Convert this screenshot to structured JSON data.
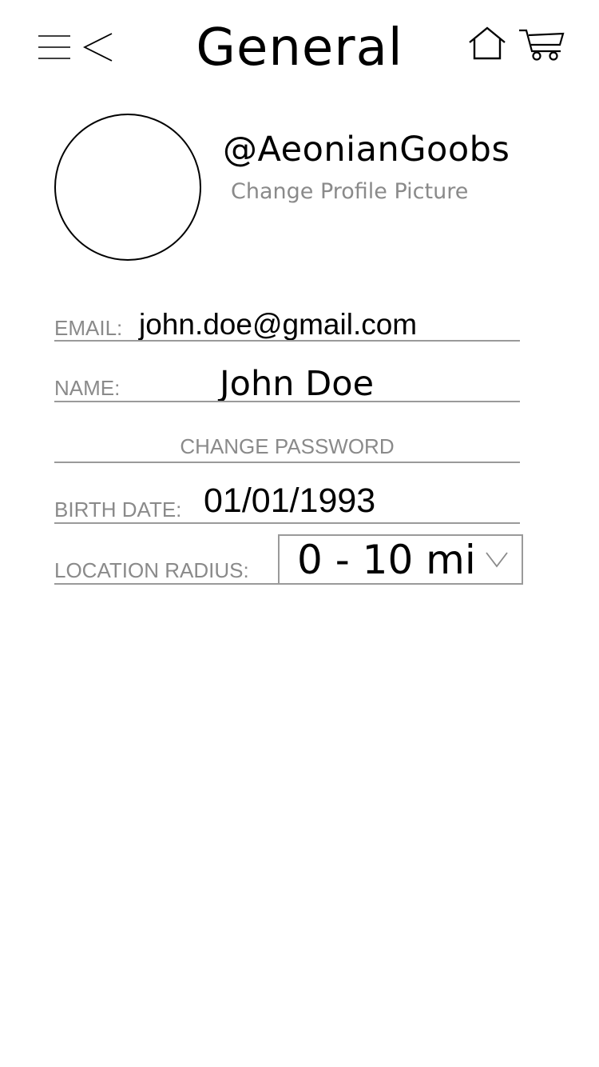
{
  "header": {
    "title": "General",
    "menu_icon": "menu-icon",
    "back_icon": "back-chevron-icon",
    "home_icon": "home-icon",
    "cart_icon": "cart-icon"
  },
  "profile": {
    "username": "@AeonianGoobs",
    "change_picture_label": "Change Profile Picture",
    "avatar_icon": "avatar-placeholder"
  },
  "form": {
    "email": {
      "label": "EMAIL:",
      "value": "john.doe@gmail.com"
    },
    "name": {
      "label": "NAME:",
      "value": "John Doe"
    },
    "change_password_label": "CHANGE PASSWORD",
    "birth_date": {
      "label": "BIRTH DATE:",
      "value": "01/01/1993"
    },
    "location_radius": {
      "label": "LOCATION RADIUS:",
      "selected": "0 - 10 mi",
      "chevron_icon": "chevron-down-icon"
    }
  },
  "colors": {
    "label_gray": "#8a8a8a",
    "line_gray": "#9a9a9a",
    "text": "#000000",
    "background": "#ffffff"
  }
}
